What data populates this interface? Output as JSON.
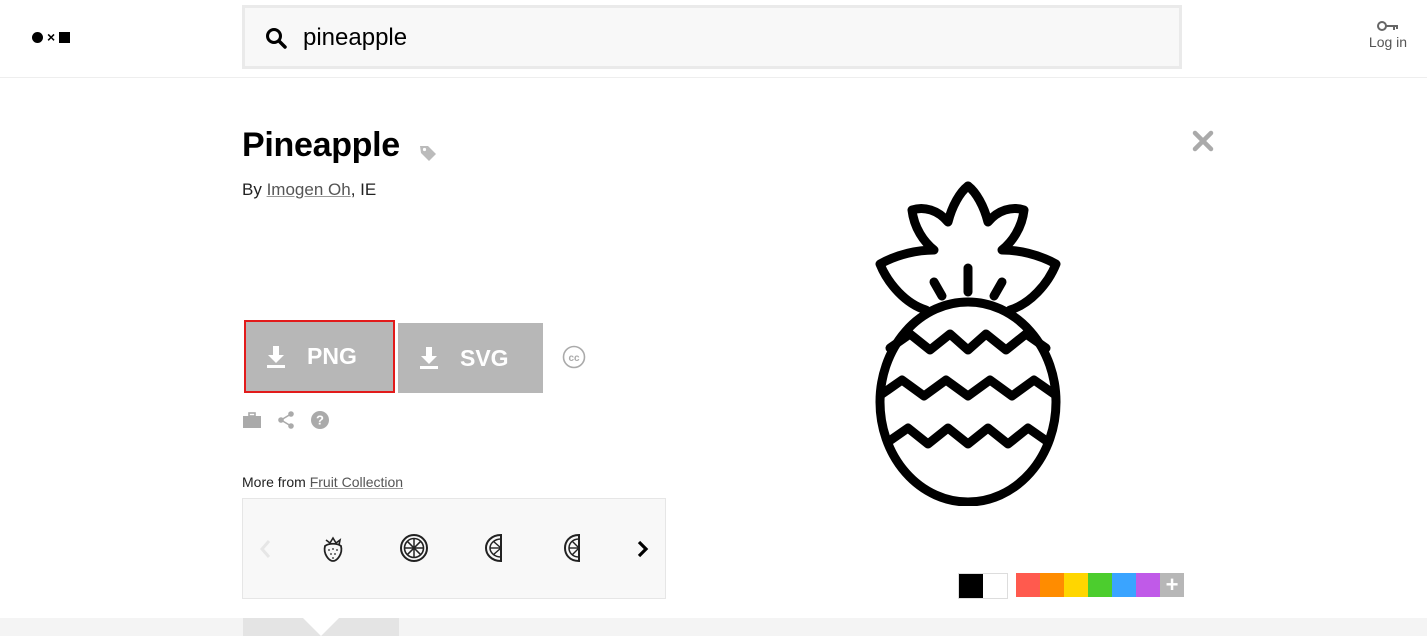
{
  "header": {
    "search": {
      "value": "pineapple",
      "icon": "search-icon"
    },
    "login": {
      "label": "Log in",
      "icon": "key-icon"
    }
  },
  "icon_detail": {
    "title": "Pineapple",
    "by_prefix": "By",
    "author": "Imogen Oh",
    "author_suffix": ", IE",
    "download": {
      "png_label": "PNG",
      "svg_label": "SVG"
    },
    "more_from_prefix": "More from",
    "collection": "Fruit Collection",
    "carousel_items": [
      "strawberry-icon",
      "orange-slice-icon",
      "lemon-half-icon",
      "lime-half-icon"
    ]
  },
  "colors": {
    "accent_highlight": "#e21b1b",
    "button_gray": "#b7b7b7",
    "swatches_bw": [
      "#000000",
      "#ffffff"
    ],
    "swatches_color": [
      "#ff5a4e",
      "#ff8c00",
      "#ffd600",
      "#4ccd2e",
      "#3aa4ff",
      "#c05ae8"
    ]
  }
}
